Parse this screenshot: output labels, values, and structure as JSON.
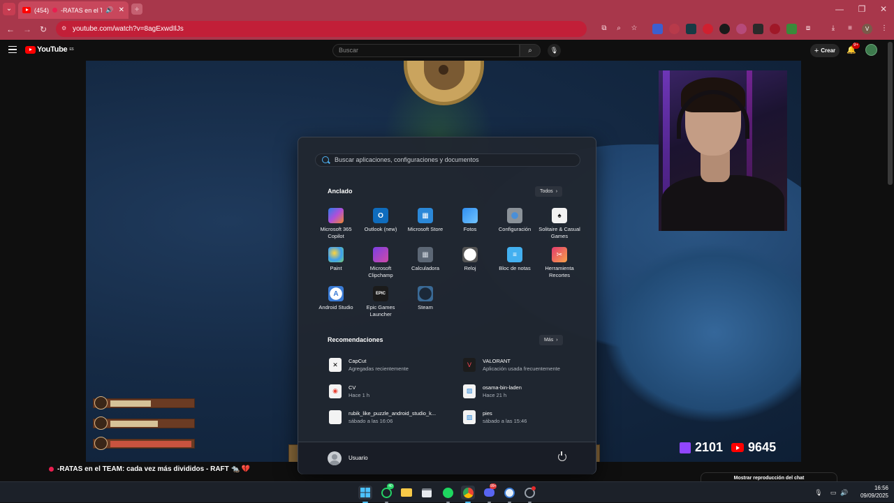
{
  "browser": {
    "tab": {
      "count": "(454)",
      "title": "-RATAS en el TEAM",
      "muted_icon": "speaker-icon"
    },
    "url": "youtube.com/watch?v=8agExwdIlJs"
  },
  "youtube": {
    "logo": "YouTube",
    "region": "ES",
    "search_placeholder": "Buscar",
    "create_label": "Crear",
    "notifications_badge": "9+"
  },
  "video": {
    "title": "-RATAS en el TEAM: cada vez más divididos - RAFT 🐀 💔",
    "twitch_count": "2101",
    "youtube_count": "9645",
    "hud_levels": [
      0.48,
      0.57,
      0.97
    ],
    "chat_replay_button": "Mostrar reproducción del chat"
  },
  "start_menu": {
    "search_placeholder": "Buscar aplicaciones, configuraciones y documentos",
    "pinned_title": "Anclado",
    "all_button": "Todos",
    "pinned": [
      {
        "label": "Microsoft 365 Copilot",
        "icon": "m365-copilot-icon"
      },
      {
        "label": "Outlook (new)",
        "icon": "outlook-icon"
      },
      {
        "label": "Microsoft Store",
        "icon": "store-icon"
      },
      {
        "label": "Fotos",
        "icon": "photos-icon"
      },
      {
        "label": "Configuración",
        "icon": "settings-icon"
      },
      {
        "label": "Solitaire & Casual Games",
        "icon": "solitaire-icon"
      },
      {
        "label": "Paint",
        "icon": "paint-icon"
      },
      {
        "label": "Microsoft Clipchamp",
        "icon": "clipchamp-icon"
      },
      {
        "label": "Calculadora",
        "icon": "calculator-icon"
      },
      {
        "label": "Reloj",
        "icon": "clock-icon"
      },
      {
        "label": "Bloc de notas",
        "icon": "notepad-icon"
      },
      {
        "label": "Herramienta Recortes",
        "icon": "snipping-tool-icon"
      },
      {
        "label": "Android Studio",
        "icon": "android-studio-icon"
      },
      {
        "label": "Epic Games Launcher",
        "icon": "epic-games-icon"
      },
      {
        "label": "Steam",
        "icon": "steam-icon"
      }
    ],
    "recommended_title": "Recomendaciones",
    "more_button": "Más",
    "recommended": [
      {
        "name": "CapCut",
        "detail": "Agregadas recientemente",
        "icon": "capcut-icon"
      },
      {
        "name": "VALORANT",
        "detail": "Aplicación usada frecuentemente",
        "icon": "valorant-icon"
      },
      {
        "name": "CV",
        "detail": "Hace 1 h",
        "icon": "chrome-doc-icon"
      },
      {
        "name": "osama-bin-laden",
        "detail": "Hace 21 h",
        "icon": "image-file-icon"
      },
      {
        "name": "rubik_like_puzzle_android_studio_k...",
        "detail": "sábado a las 16:06",
        "icon": "file-icon"
      },
      {
        "name": "pies",
        "detail": "sábado a las 15:46",
        "icon": "image-file-icon"
      }
    ],
    "user_name": "Usuario"
  },
  "taskbar": {
    "whatsapp_badge": "40",
    "discord_badge": "99+",
    "time": "16:56",
    "date": "09/09/2025"
  }
}
